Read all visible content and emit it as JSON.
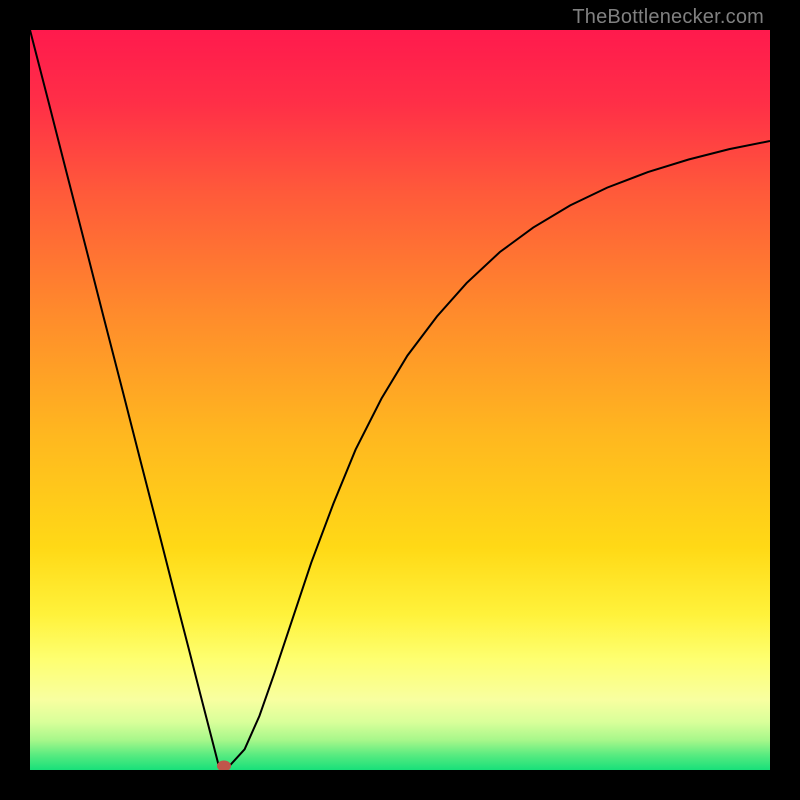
{
  "watermark": "TheBottlenecker.com",
  "chart_data": {
    "type": "line",
    "title": "",
    "xlabel": "",
    "ylabel": "",
    "xlim": [
      0,
      100
    ],
    "ylim": [
      0,
      100
    ],
    "background_gradient": {
      "stops": [
        {
          "offset": 0.0,
          "color": "#ff1a4d"
        },
        {
          "offset": 0.1,
          "color": "#ff2f47"
        },
        {
          "offset": 0.22,
          "color": "#ff5a3a"
        },
        {
          "offset": 0.38,
          "color": "#ff8a2c"
        },
        {
          "offset": 0.55,
          "color": "#ffb81f"
        },
        {
          "offset": 0.7,
          "color": "#ffd916"
        },
        {
          "offset": 0.79,
          "color": "#fff23b"
        },
        {
          "offset": 0.85,
          "color": "#feff70"
        },
        {
          "offset": 0.905,
          "color": "#f8ffa0"
        },
        {
          "offset": 0.935,
          "color": "#d9ff9a"
        },
        {
          "offset": 0.96,
          "color": "#a6f78a"
        },
        {
          "offset": 0.98,
          "color": "#57eb80"
        },
        {
          "offset": 1.0,
          "color": "#18e07a"
        }
      ]
    },
    "series": [
      {
        "name": "bottleneck-curve",
        "color": "#000000",
        "stroke_width": 2,
        "x": [
          0.0,
          2.5,
          5.0,
          7.5,
          10.0,
          12.5,
          15.0,
          17.5,
          20.0,
          21.5,
          23.0,
          24.5,
          25.5,
          27.0,
          29.0,
          31.0,
          33.0,
          35.5,
          38.0,
          41.0,
          44.0,
          47.5,
          51.0,
          55.0,
          59.0,
          63.5,
          68.0,
          73.0,
          78.0,
          83.5,
          89.0,
          94.5,
          100.0
        ],
        "y": [
          100.0,
          90.3,
          80.5,
          70.8,
          61.0,
          51.3,
          41.5,
          31.8,
          22.0,
          16.2,
          10.3,
          4.5,
          0.6,
          0.6,
          2.8,
          7.3,
          13.0,
          20.5,
          28.0,
          36.0,
          43.3,
          50.2,
          56.0,
          61.3,
          65.8,
          70.0,
          73.3,
          76.3,
          78.7,
          80.8,
          82.5,
          83.9,
          85.0
        ]
      }
    ],
    "marker": {
      "x": 26.2,
      "y": 0.6,
      "color": "#c0564b"
    }
  }
}
